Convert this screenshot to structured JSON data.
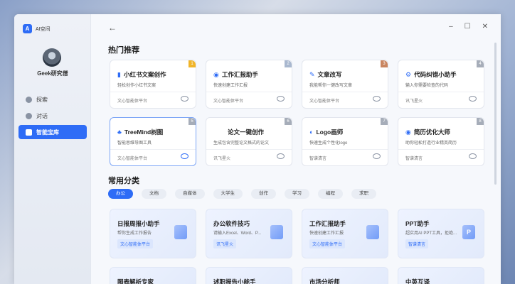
{
  "app": {
    "logo_text": "A",
    "name": "AI空间"
  },
  "user": {
    "name": "Geek研究僧"
  },
  "nav": [
    {
      "label": "探索",
      "icon": "compass-icon",
      "active": false
    },
    {
      "label": "对话",
      "icon": "chat-icon",
      "active": false
    },
    {
      "label": "智能宝库",
      "icon": "treasure-box-icon",
      "active": true
    }
  ],
  "window_controls": {
    "back": "←",
    "minimize": "–",
    "maximize": "☐",
    "close": "✕"
  },
  "hot": {
    "title": "热门推荐",
    "cards": [
      {
        "rank": "1",
        "icon": "▮",
        "title": "小红书文案创作",
        "desc": "轻松创作小红书文案",
        "source": "文心智能体平台"
      },
      {
        "rank": "2",
        "icon": "◉",
        "title": "工作汇报助手",
        "desc": "快速创建工作汇报",
        "source": "文心智能体平台"
      },
      {
        "rank": "3",
        "icon": "✎",
        "title": "文章改写",
        "desc": "我能帮你一键改写文章",
        "source": "文心智能体平台"
      },
      {
        "rank": "4",
        "icon": "⚙",
        "title": "代码纠错小助手",
        "desc": "输入你需要检查的代码",
        "source": "讯飞星火"
      },
      {
        "rank": "5",
        "icon": "♣",
        "title": "TreeMind树图",
        "desc": "智能思维导图工具",
        "source": "文心智能体平台"
      },
      {
        "rank": "6",
        "icon": "",
        "title": "论文一键创作",
        "desc": "生成包含完整论文格式的论文",
        "source": "讯飞星火"
      },
      {
        "rank": "7",
        "icon": "◐",
        "title": "Logo画师",
        "desc": "快速生成个性化logo",
        "source": "智谱清言"
      },
      {
        "rank": "8",
        "icon": "◉",
        "title": "简历优化大师",
        "desc": "助你轻松打造行业精英简历",
        "source": "智谱清言"
      }
    ]
  },
  "categories": {
    "title": "常用分类",
    "items": [
      "办公",
      "文档",
      "自媒体",
      "大学生",
      "创作",
      "学习",
      "编程",
      "求职"
    ],
    "active_index": 0
  },
  "tools": [
    {
      "title": "日报周报小助手",
      "desc": "帮你生成工作报告",
      "tag": "文心智能体平台",
      "art": ""
    },
    {
      "title": "办公软件技巧",
      "desc": "请输入Excel、Word、P...",
      "tag": "讯飞星火",
      "art": ""
    },
    {
      "title": "工作汇报助手",
      "desc": "快速创建工作汇报",
      "tag": "文心智能体平台",
      "art": ""
    },
    {
      "title": "PPT助手",
      "desc": "超实用AI PPT工具，拒绝...",
      "tag": "智谱清言",
      "art": "P"
    },
    {
      "title": "图表解析专家",
      "desc": "",
      "tag": "",
      "art": ""
    },
    {
      "title": "述职报告小能手",
      "desc": "",
      "tag": "",
      "art": ""
    },
    {
      "title": "市场分析师",
      "desc": "",
      "tag": "",
      "art": ""
    },
    {
      "title": "中英互译",
      "desc": "",
      "tag": "",
      "art": ""
    }
  ]
}
